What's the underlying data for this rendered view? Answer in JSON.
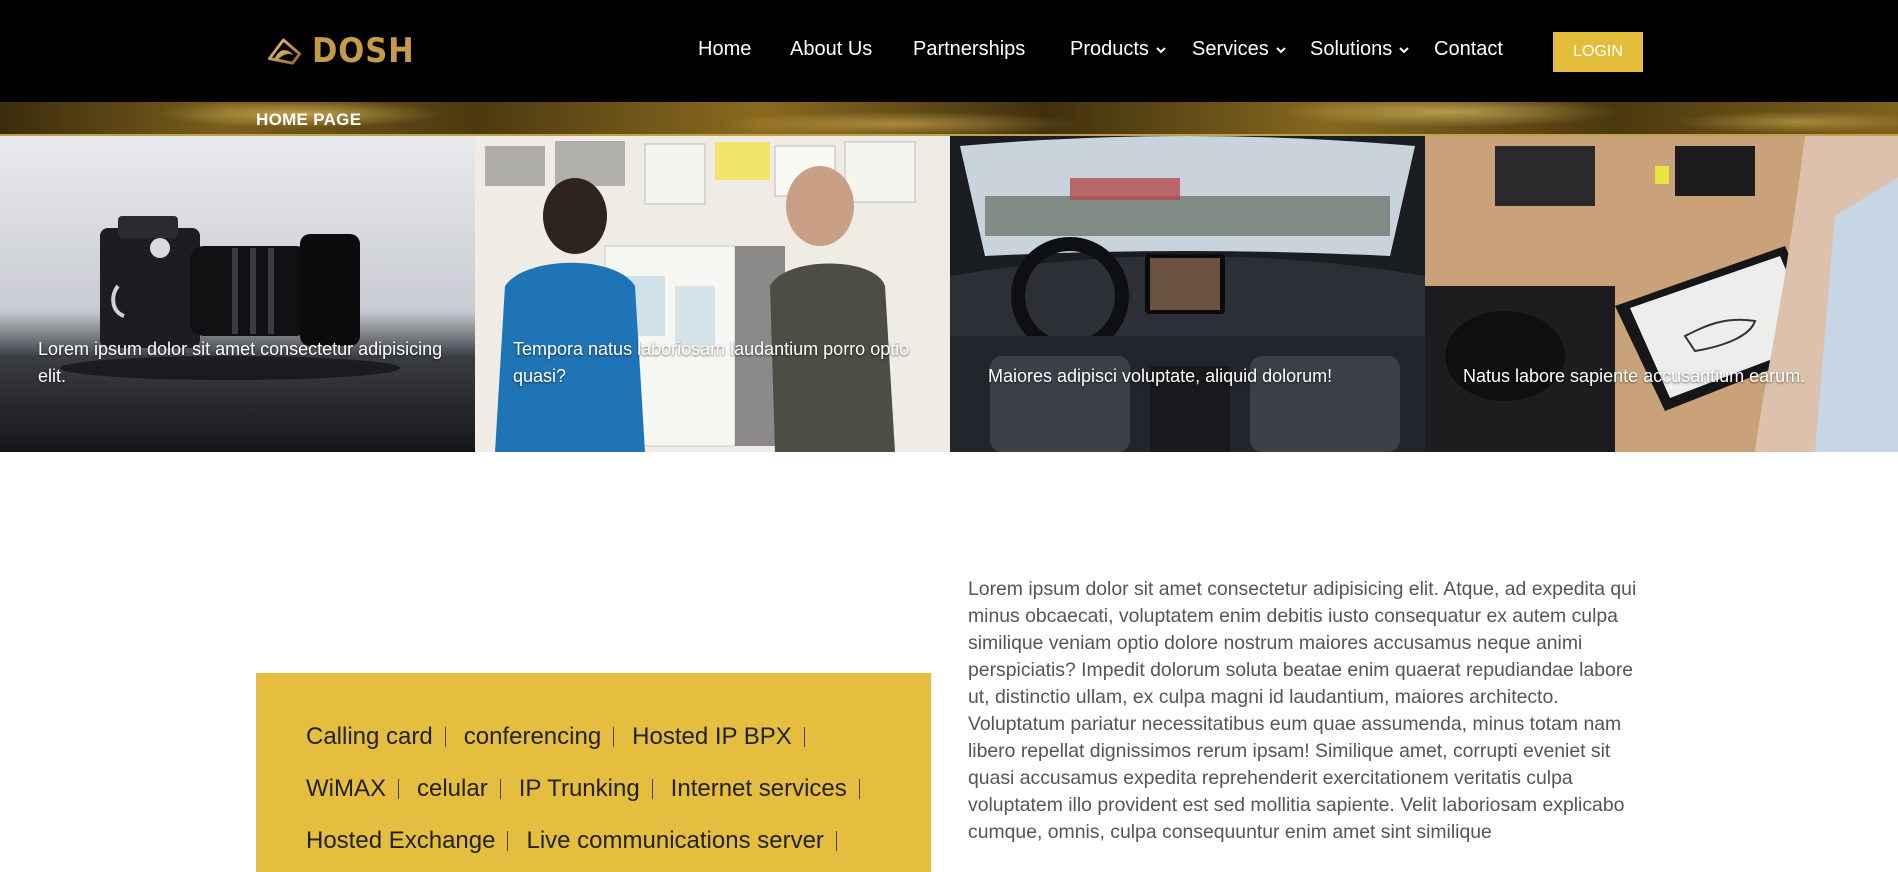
{
  "brand": {
    "name": "DOSH",
    "logo_icon": "dosh-logo-icon",
    "accent_color": "#e4bd3a",
    "logo_color": "#c79a4a"
  },
  "nav": {
    "items": [
      {
        "label": "Home",
        "dropdown": false
      },
      {
        "label": "About Us",
        "dropdown": false
      },
      {
        "label": "Partnerships",
        "dropdown": false
      },
      {
        "label": "Products",
        "dropdown": true
      },
      {
        "label": "Services",
        "dropdown": true
      },
      {
        "label": "Solutions",
        "dropdown": true
      },
      {
        "label": "Contact",
        "dropdown": false
      }
    ],
    "login_label": "LOGIN"
  },
  "breadcrumb": {
    "title": "HOME PAGE"
  },
  "tiles": [
    {
      "image": "camera-photo",
      "caption": "Lorem ipsum dolor sit amet consectetur adipisicing elit."
    },
    {
      "image": "designers-at-board-photo",
      "caption": "Tempora natus laboriosam laudantium porro optio quasi?"
    },
    {
      "image": "car-interior-photo",
      "caption": "Maiores adipisci voluptate, aliquid dolorum!"
    },
    {
      "image": "tablet-sketching-photo",
      "caption": "Natus labore sapiente accusantium earum."
    }
  ],
  "services": {
    "items": [
      "Calling card",
      "conferencing",
      "Hosted IP BPX",
      "WiMAX",
      "celular",
      "IP Trunking",
      "Internet services",
      "Hosted Exchange",
      "Live communications server"
    ],
    "box_color": "#e5be3f"
  },
  "intro": {
    "text": "Lorem ipsum dolor sit amet consectetur adipisicing elit. Atque, ad expedita qui minus obcaecati, voluptatem enim debitis iusto consequatur ex autem culpa similique veniam optio dolore nostrum maiores accusamus neque animi perspiciatis? Impedit dolorum soluta beatae enim quaerat repudiandae labore ut, distinctio ullam, ex culpa magni id laudantium, maiores architecto. Voluptatum pariatur necessitatibus eum quae assumenda, minus totam nam libero repellat dignissimos rerum ipsam! Similique amet, corrupti eveniet sit quasi accusamus expedita reprehenderit exercitationem veritatis culpa voluptatem illo provident est sed mollitia sapiente. Velit laboriosam explicabo cumque, omnis, culpa consequuntur enim amet sint similique"
  }
}
